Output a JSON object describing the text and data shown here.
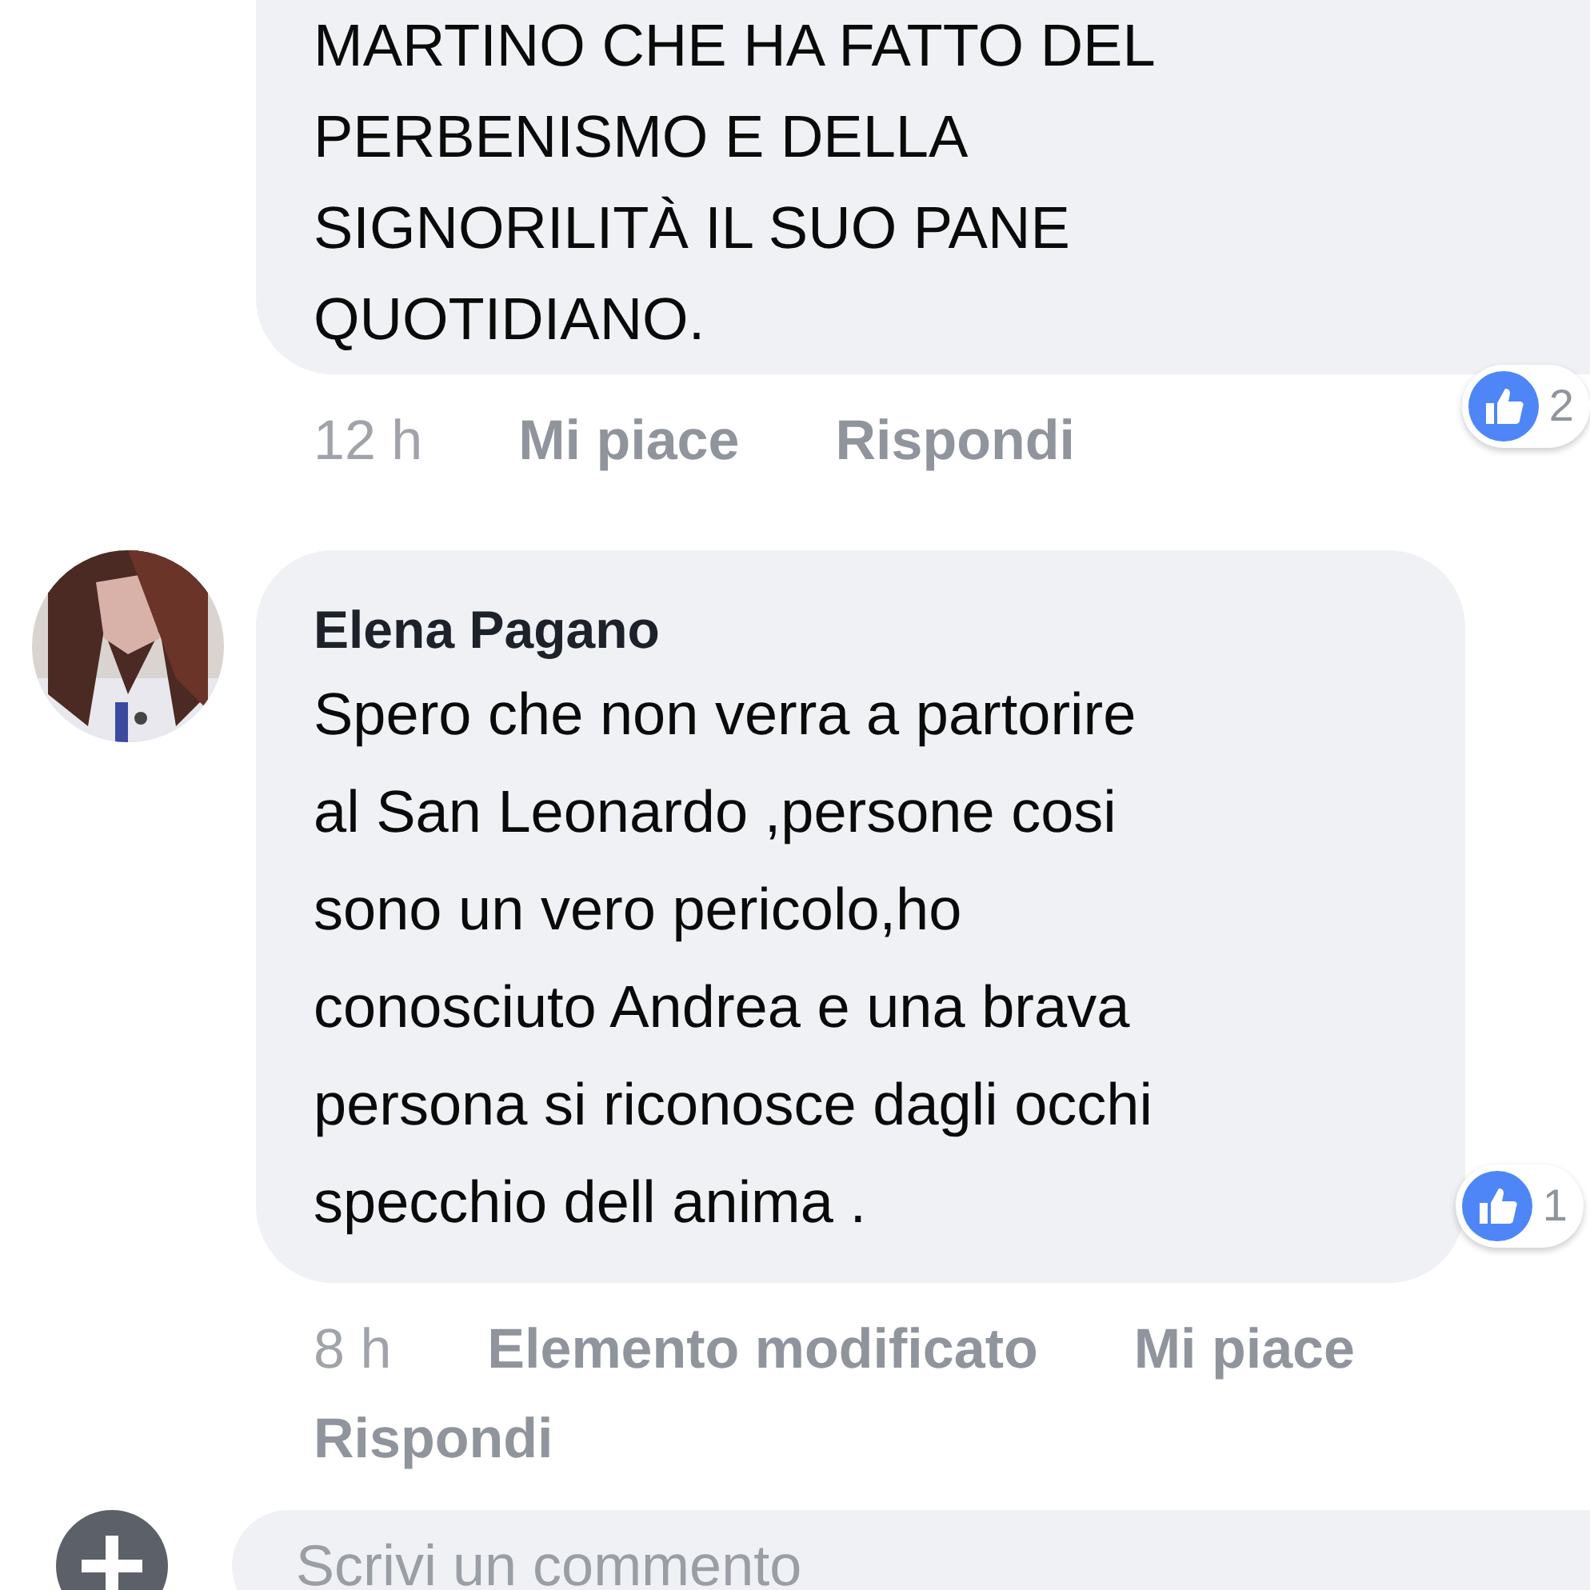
{
  "comments": [
    {
      "text": "MARTINO CHE HA FATTO DEL\nPERBENISMO E DELLA\nSIGNORILITÀ IL SUO PANE\nQUOTIDIANO.",
      "time": "12 h",
      "meta": [
        "Mi piace",
        "Rispondi"
      ],
      "reaction_count": "2"
    },
    {
      "author": "Elena Pagano",
      "text": "Spero che non verra a partorire\nal San Leonardo ,persone cosi\nsono un vero pericolo,ho\nconosciuto Andrea e una brava\npersona si riconosce dagli occhi\nspecchio dell anima .",
      "time": "8 h",
      "meta": [
        "Elemento modificato",
        "Mi piace",
        "Rispondi"
      ],
      "reaction_count": "1"
    }
  ],
  "composer": {
    "placeholder": "Scrivi un commento"
  }
}
